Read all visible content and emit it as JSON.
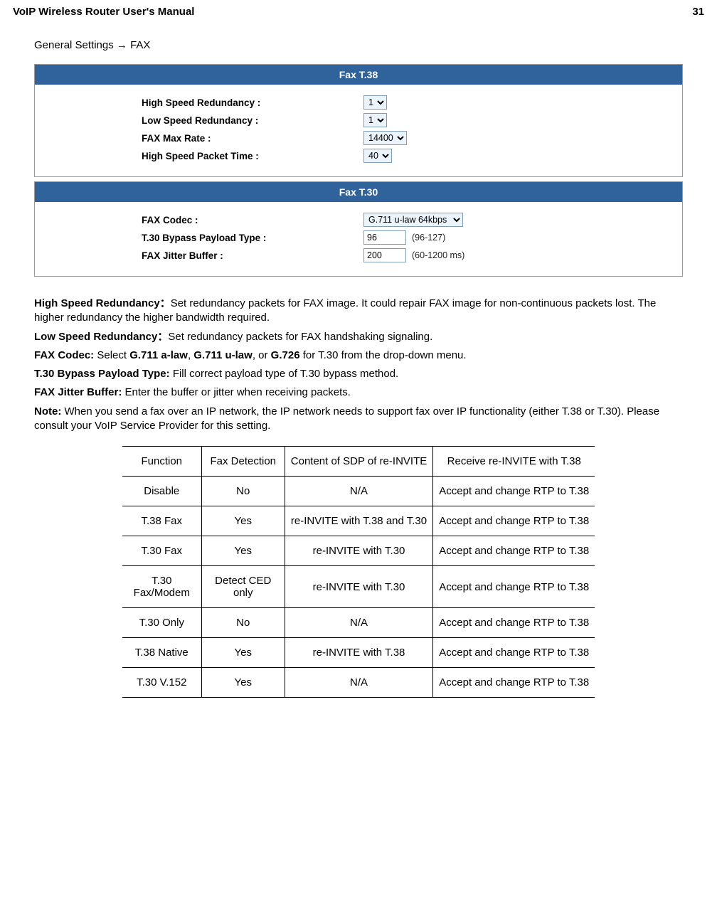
{
  "header": {
    "title": "VoIP Wireless Router User's Manual",
    "page": "31"
  },
  "breadcrumb": "General Settings → FAX",
  "t38": {
    "title": "Fax T.38",
    "high_redundancy_lbl": "High Speed Redundancy :",
    "high_redundancy_val": "1",
    "low_redundancy_lbl": "Low Speed Redundancy :",
    "low_redundancy_val": "1",
    "max_rate_lbl": "FAX Max Rate :",
    "max_rate_val": "14400",
    "hspt_lbl": "High Speed Packet Time :",
    "hspt_val": "40"
  },
  "t30": {
    "title": "Fax T.30",
    "codec_lbl": "FAX Codec :",
    "codec_val": "G.711 u-law 64kbps",
    "payload_lbl": "T.30 Bypass Payload Type :",
    "payload_val": "96",
    "payload_hint": "(96-127)",
    "jitter_lbl": "FAX Jitter Buffer :",
    "jitter_val": "200",
    "jitter_hint": "(60-1200 ms)"
  },
  "desc": {
    "hs_b": "High Speed Redundancy：",
    "hs": "Set redundancy packets for FAX image. It could repair FAX image for non-continuous packets lost. The higher redundancy the higher bandwidth required.",
    "ls_b": "Low Speed Redundancy：",
    "ls": "Set redundancy packets for FAX handshaking signaling.",
    "codec_b": "FAX Codec: ",
    "codec_1": "Select ",
    "codec_g711a": "G.711 a-law",
    "codec_c1": ", ",
    "codec_g711u": "G.711 u-law",
    "codec_c2": ", or ",
    "codec_g726": "G.726",
    "codec_after": " for T.30 from the drop-down menu.",
    "pl_b": "T.30 Bypass Payload Type: ",
    "pl": "Fill correct payload type of T.30 bypass method.",
    "jb_b": "FAX Jitter Buffer: ",
    "jb": "Enter the buffer or jitter when receiving packets.",
    "note_b": "Note: ",
    "note": "When you send a fax over an IP network, the IP network needs to support fax over IP functionality (either T.38 or T.30). Please consult your VoIP Service Provider for this setting."
  },
  "table": {
    "h": [
      "Function",
      "Fax Detection",
      "Content of SDP of re-INVITE",
      "Receive re-INVITE with T.38"
    ],
    "rows": [
      [
        "Disable",
        "No",
        "N/A",
        "Accept and change RTP to T.38"
      ],
      [
        "T.38 Fax",
        "Yes",
        "re-INVITE with T.38 and T.30",
        "Accept and change RTP to T.38"
      ],
      [
        "T.30 Fax",
        "Yes",
        "re-INVITE with T.30",
        "Accept and change RTP to T.38"
      ],
      [
        "T.30 Fax/Modem",
        "Detect CED only",
        "re-INVITE with T.30",
        "Accept and change RTP to T.38"
      ],
      [
        "T.30 Only",
        "No",
        "N/A",
        "Accept and change RTP to T.38"
      ],
      [
        "T.38 Native",
        "Yes",
        "re-INVITE with T.38",
        "Accept and change RTP to T.38"
      ],
      [
        "T.30 V.152",
        "Yes",
        "N/A",
        "Accept and change RTP to T.38"
      ]
    ]
  }
}
